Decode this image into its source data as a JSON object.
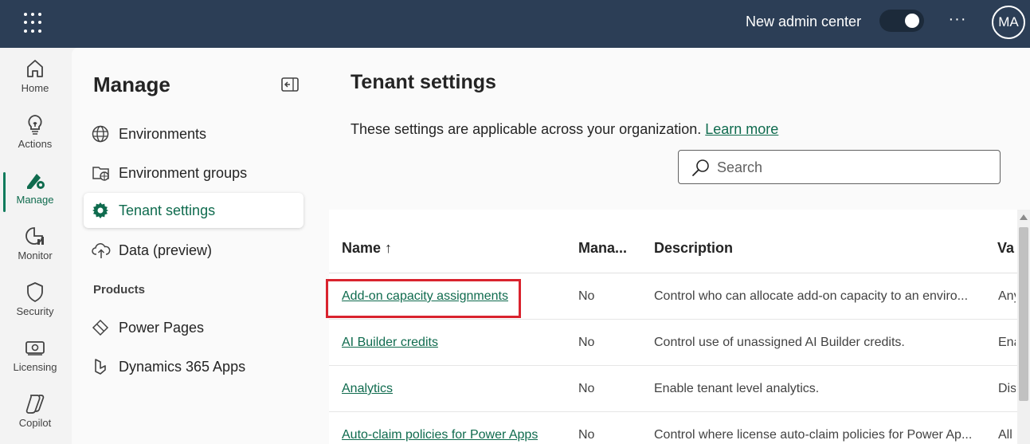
{
  "topbar": {
    "admin_center_label": "New admin center",
    "toggle_on": true,
    "more_label": "···",
    "avatar_initials": "MA"
  },
  "rail": {
    "items": [
      {
        "label": "Home",
        "icon": "home-icon"
      },
      {
        "label": "Actions",
        "icon": "lightbulb-icon"
      },
      {
        "label": "Manage",
        "icon": "manage-icon",
        "active": true
      },
      {
        "label": "Monitor",
        "icon": "monitor-icon"
      },
      {
        "label": "Security",
        "icon": "shield-icon"
      },
      {
        "label": "Licensing",
        "icon": "licensing-icon"
      },
      {
        "label": "Copilot",
        "icon": "copilot-icon"
      }
    ]
  },
  "manage": {
    "title": "Manage",
    "items": [
      {
        "label": "Environments",
        "icon": "globe-icon"
      },
      {
        "label": "Environment groups",
        "icon": "folder-globe-icon"
      },
      {
        "label": "Tenant settings",
        "icon": "gear-icon",
        "active": true
      },
      {
        "label": "Data (preview)",
        "icon": "cloud-upload-icon"
      }
    ],
    "products_label": "Products",
    "products": [
      {
        "label": "Power Pages",
        "icon": "power-pages-icon"
      },
      {
        "label": "Dynamics 365 Apps",
        "icon": "dynamics-icon"
      }
    ]
  },
  "main": {
    "title": "Tenant settings",
    "subtitle": "These settings are applicable across your organization.",
    "learn_more": "Learn more",
    "search_placeholder": "Search",
    "columns": {
      "name": "Name ↑",
      "managed": "Mana...",
      "description": "Description",
      "value": "Va"
    },
    "rows": [
      {
        "name": "Add-on capacity assignments",
        "managed": "No",
        "description": "Control who can allocate add-on capacity to an enviro...",
        "value": "Any"
      },
      {
        "name": "AI Builder credits",
        "managed": "No",
        "description": "Control use of unassigned AI Builder credits.",
        "value": "Ena"
      },
      {
        "name": "Analytics",
        "managed": "No",
        "description": "Enable tenant level analytics.",
        "value": "Dis"
      },
      {
        "name": "Auto-claim policies for Power Apps",
        "managed": "No",
        "description": "Control where license auto-claim policies for Power Ap...",
        "value": "All"
      }
    ]
  },
  "colors": {
    "topbar": "#2c3e56",
    "accent_green": "#0f6b4e",
    "highlight_red": "#d9232e"
  }
}
